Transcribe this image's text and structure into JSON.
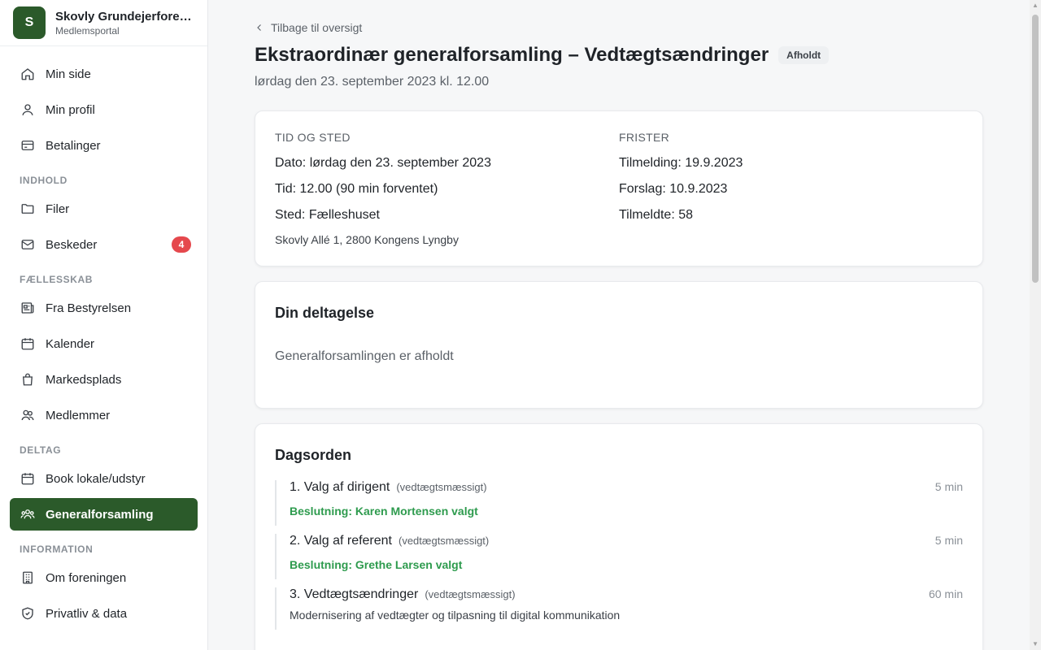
{
  "brand": {
    "logo_letter": "S",
    "name": "Skovly Grundejerforeni...",
    "subtitle": "Medlemsportal",
    "color": "#2b5a2a"
  },
  "sidebar": {
    "items_top": [
      {
        "label": "Min side",
        "icon": "home-icon"
      },
      {
        "label": "Min profil",
        "icon": "user-icon"
      },
      {
        "label": "Betalinger",
        "icon": "card-icon"
      }
    ],
    "sections": [
      {
        "title": "INDHOLD",
        "items": [
          {
            "label": "Filer",
            "icon": "folder-icon"
          },
          {
            "label": "Beskeder",
            "icon": "mail-icon",
            "badge": "4"
          }
        ]
      },
      {
        "title": "FÆLLESSKAB",
        "items": [
          {
            "label": "Fra Bestyrelsen",
            "icon": "newspaper-icon"
          },
          {
            "label": "Kalender",
            "icon": "calendar-icon"
          },
          {
            "label": "Markedsplads",
            "icon": "bag-icon"
          },
          {
            "label": "Medlemmer",
            "icon": "users-icon"
          }
        ]
      },
      {
        "title": "DELTAG",
        "items": [
          {
            "label": "Book lokale/udstyr",
            "icon": "calendar-icon"
          },
          {
            "label": "Generalforsamling",
            "icon": "group-icon",
            "active": true
          }
        ]
      },
      {
        "title": "INFORMATION",
        "items": [
          {
            "label": "Om foreningen",
            "icon": "building-icon"
          },
          {
            "label": "Privatliv & data",
            "icon": "shield-icon"
          }
        ]
      }
    ]
  },
  "main": {
    "back_label": "Tilbage til oversigt",
    "title": "Ekstraordinær generalforsamling – Vedtægtsændringer",
    "status": "Afholdt",
    "subtitle": "lørdag den 23. september 2023 kl. 12.00",
    "info": {
      "left_heading": "TID OG STED",
      "date_label": "Dato:",
      "date_value": "lørdag den 23. september 2023",
      "time_label": "Tid:",
      "time_value": "12.00 (90 min forventet)",
      "place_label": "Sted:",
      "place_value": "Fælleshuset",
      "address": "Skovly Allé 1, 2800 Kongens Lyngby",
      "right_heading": "FRISTER",
      "signup_label": "Tilmelding:",
      "signup_value": "19.9.2023",
      "proposal_label": "Forslag:",
      "proposal_value": "10.9.2023",
      "registered_label": "Tilmeldte:",
      "registered_value": "58"
    },
    "participation": {
      "title": "Din deltagelse",
      "text": "Generalforsamlingen er afholdt"
    },
    "agenda": {
      "title": "Dagsorden",
      "items": [
        {
          "title": "1. Valg af dirigent",
          "tag": "(vedtægtsmæssigt)",
          "duration": "5 min",
          "decision": "Beslutning: Karen Mortensen valgt"
        },
        {
          "title": "2. Valg af referent",
          "tag": "(vedtægtsmæssigt)",
          "duration": "5 min",
          "decision": "Beslutning: Grethe Larsen valgt"
        },
        {
          "title": "3. Vedtægtsændringer",
          "tag": "(vedtægtsmæssigt)",
          "duration": "60 min",
          "description": "Modernisering af vedtægter og tilpasning til digital kommunikation"
        }
      ]
    }
  }
}
